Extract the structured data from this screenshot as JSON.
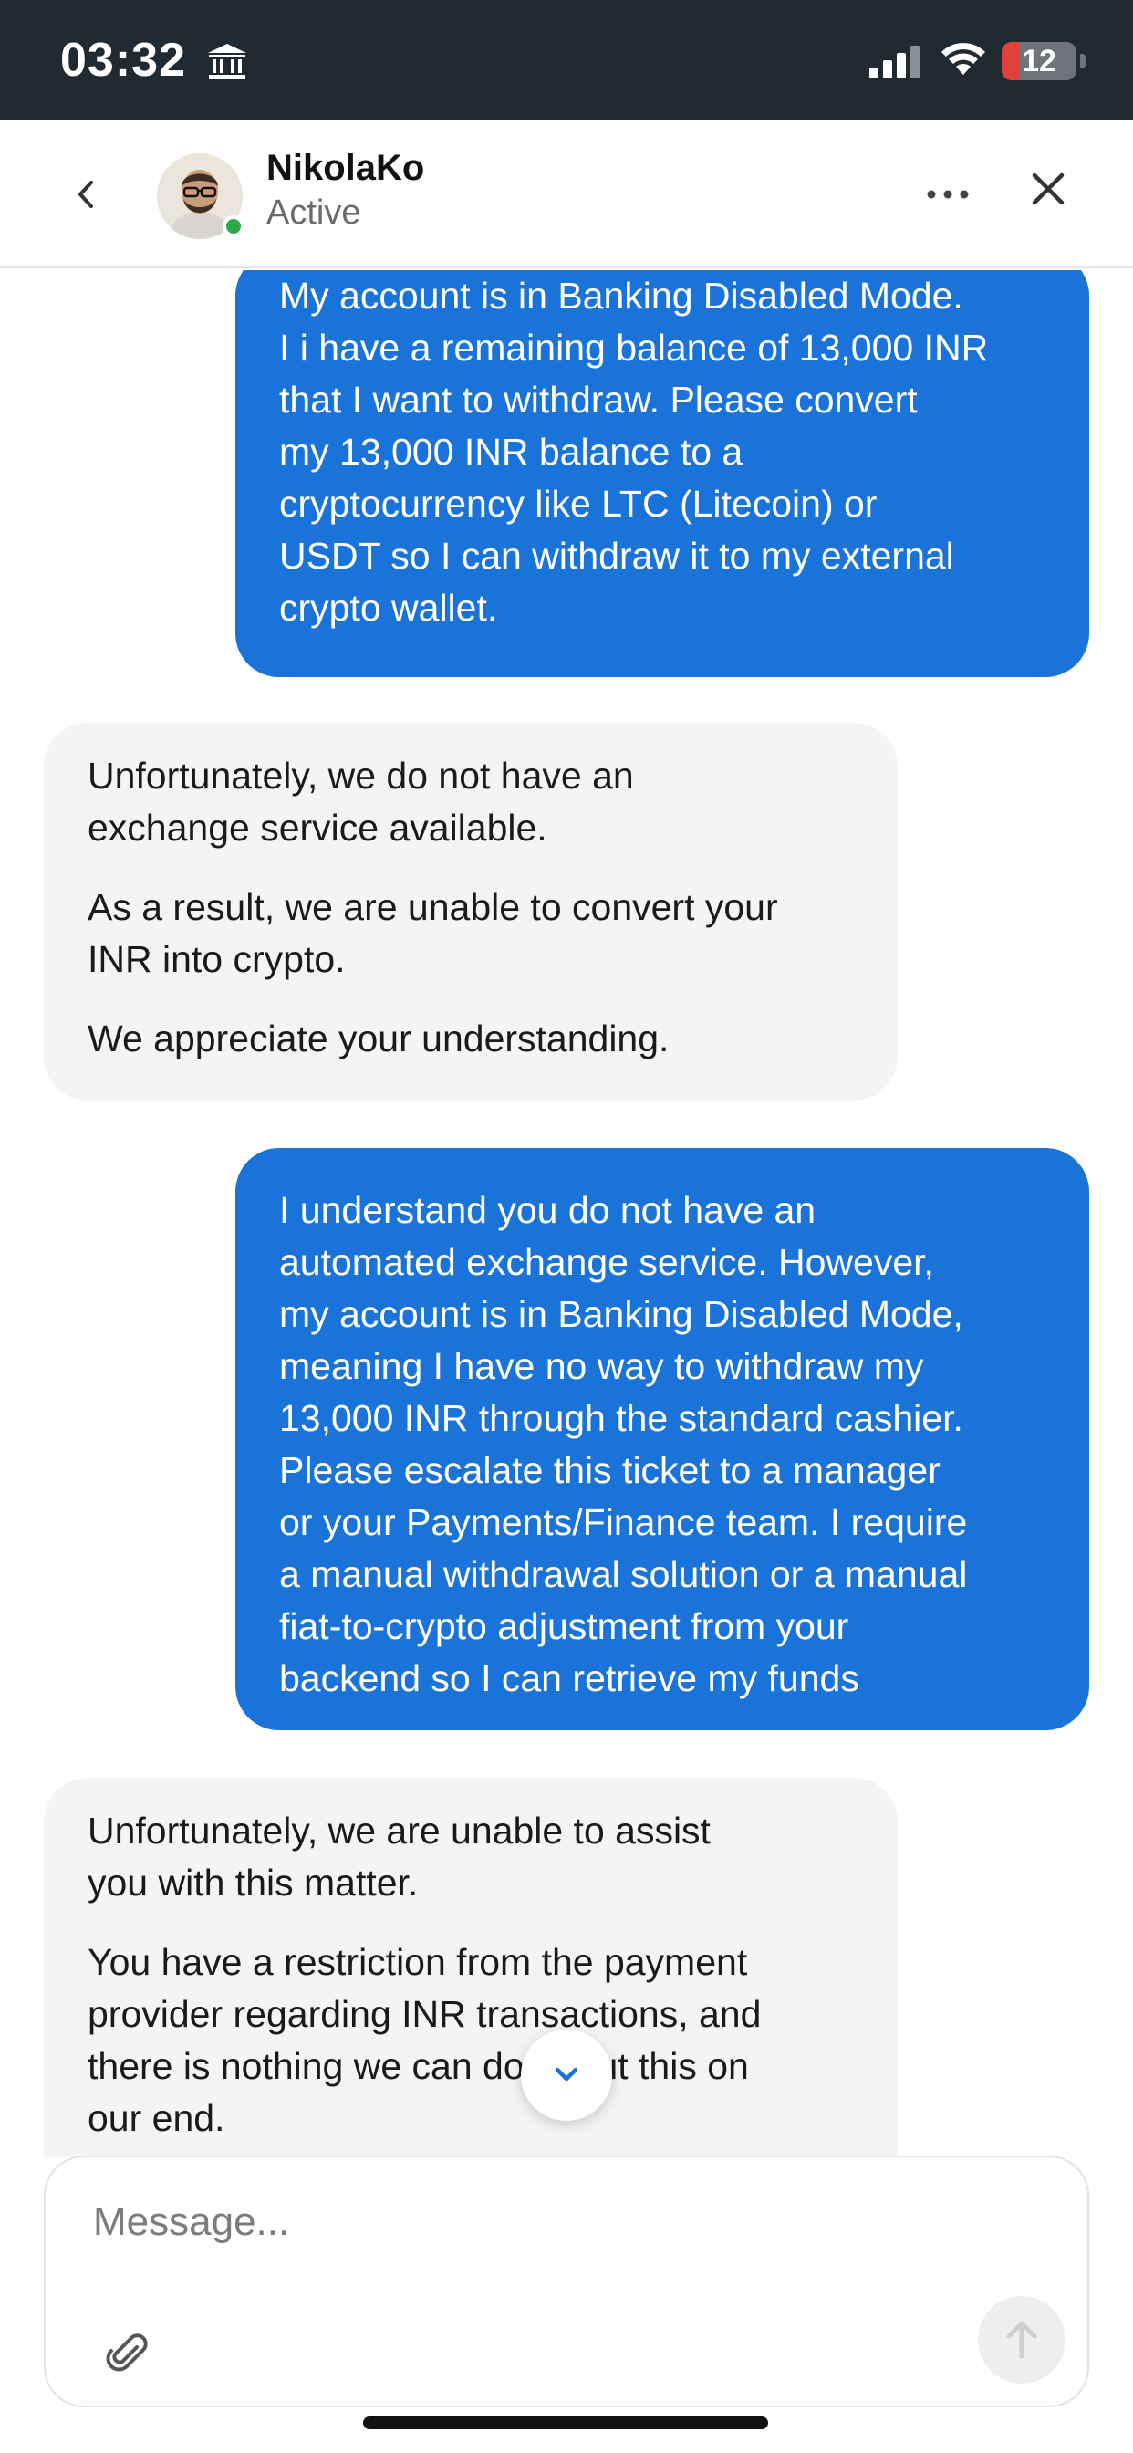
{
  "status_bar": {
    "time": "03:32",
    "battery": "12",
    "icons": [
      "bank-icon",
      "cellular-signal-icon",
      "wifi-icon",
      "battery-icon"
    ]
  },
  "header": {
    "agent_name": "NikolaKo",
    "agent_status": "Active",
    "icons": [
      "chevron-left-icon",
      "more-horizontal-icon",
      "close-icon"
    ],
    "online_color": "#2ca84a"
  },
  "messages": [
    {
      "direction": "outgoing",
      "paragraphs": [
        "My account is in Banking Disabled Mode.\nI i have a remaining balance of 13,000 INR\nthat I want to withdraw. Please convert\nmy 13,000 INR balance to a\ncryptocurrency like LTC (Litecoin) or\nUSDT so I can withdraw it to my external\ncrypto wallet."
      ]
    },
    {
      "direction": "incoming",
      "paragraphs": [
        "Unfortunately, we do not have an\nexchange service available.",
        "As a result, we are unable to convert your\nINR into crypto.",
        "We appreciate your understanding."
      ]
    },
    {
      "direction": "outgoing",
      "paragraphs": [
        "I understand you do not have an\nautomated exchange service. However,\nmy account is in Banking Disabled Mode,\nmeaning I have no way to withdraw my\n13,000 INR through the standard cashier.\nPlease escalate this ticket to a manager\nor your Payments/Finance team. I require\na manual withdrawal solution or a manual\nfiat-to-crypto adjustment from your\nbackend so I can retrieve my funds"
      ]
    },
    {
      "direction": "incoming",
      "paragraphs": [
        "Unfortunately, we are unable to assist\nyou with this matter.",
        "You have a restriction from the payment\nprovider regarding INR transactions, and\nthere is nothing we can do about this on\nour end."
      ]
    }
  ],
  "composer": {
    "placeholder": "Message...",
    "icons": [
      "paperclip-icon",
      "arrow-up-icon"
    ]
  },
  "colors": {
    "outgoing_bubble": "#1a73d9",
    "incoming_bubble": "#f4f4f4",
    "status_bar": "#1f2a33"
  }
}
